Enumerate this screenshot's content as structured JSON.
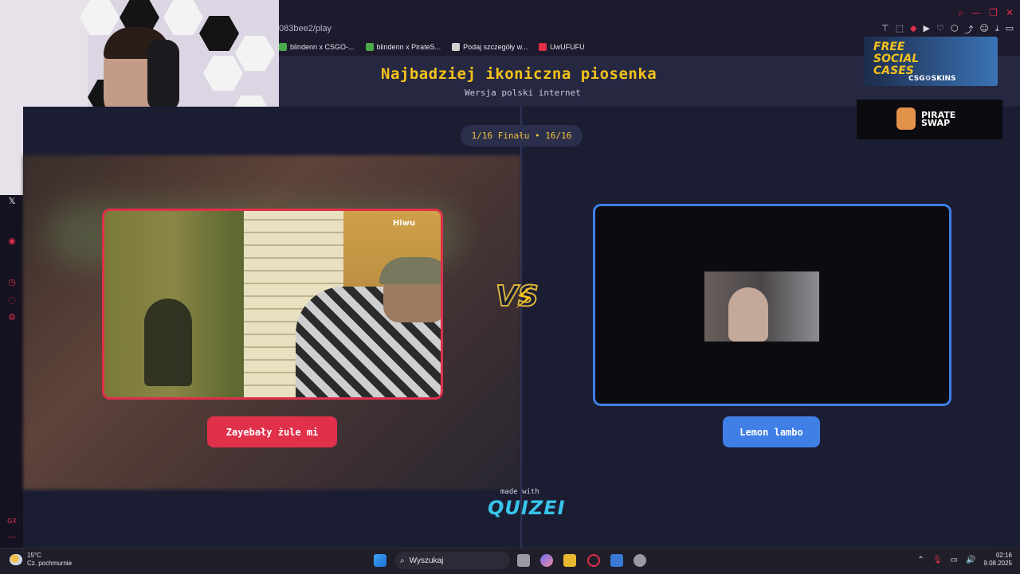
{
  "browser": {
    "url": "083bee2/play",
    "bookmarks": [
      {
        "label": "blindenn x CSGO-...",
        "color": "#4aa84a"
      },
      {
        "label": "blindenn x PirateS...",
        "color": "#4aa84a"
      },
      {
        "label": "Podaj szczegóły w...",
        "color": "#d0d0d0"
      },
      {
        "label": "UwUFUFU",
        "color": "#e0304a"
      }
    ]
  },
  "quiz": {
    "title": "Najbadziej ikoniczna piosenka",
    "subtitle": "Wersja polski internet",
    "round": "1/16 Finału • 16/16",
    "vs": "VS",
    "left_choice": "Zayebały żule mi",
    "right_choice": "Lemon lambo",
    "made_with": "made with",
    "brand": "QUIZEI",
    "left_watermark": "Hiwu"
  },
  "ads": {
    "csgo_line1": "FREE",
    "csgo_line2": "SOCIAL",
    "csgo_line3": "CASES",
    "csgo_brand": "CSG⚙SKINS",
    "pirate_line1": "PIRATE",
    "pirate_line2": "SWAP"
  },
  "taskbar": {
    "temp": "15°C",
    "weather": "Cz. pochmurnie",
    "search_placeholder": "Wyszukaj",
    "time": "02:16",
    "date": "9.08.2025"
  },
  "colors": {
    "accent_red": "#e0304a",
    "accent_blue": "#3f7fe6",
    "title_yellow": "#f3c21b",
    "brand_cyan": "#38c3ea"
  }
}
